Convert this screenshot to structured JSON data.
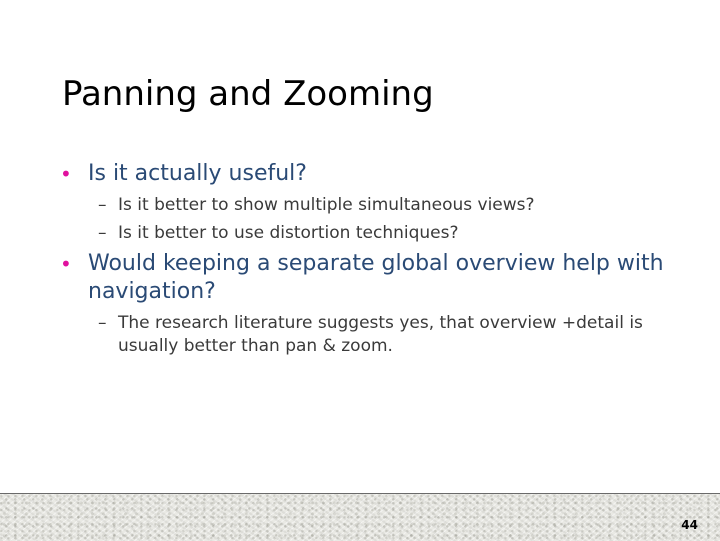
{
  "slide": {
    "title": "Panning and Zooming",
    "page_number": "44",
    "bullet_glyph": "•",
    "dash_glyph": "–",
    "colors": {
      "title": "#000000",
      "level1_text": "#2a4a75",
      "bullet": "#e0109e",
      "level2_text": "#3a3a3a"
    },
    "bullets": [
      {
        "text": "Is it actually useful?",
        "sub": [
          "Is it better to show multiple simultaneous views?",
          "Is it better to use distortion techniques?"
        ]
      },
      {
        "text": "Would keeping a separate global overview help with navigation?",
        "sub": [
          "The research literature suggests yes, that overview +detail is usually better than pan & zoom."
        ]
      }
    ]
  }
}
